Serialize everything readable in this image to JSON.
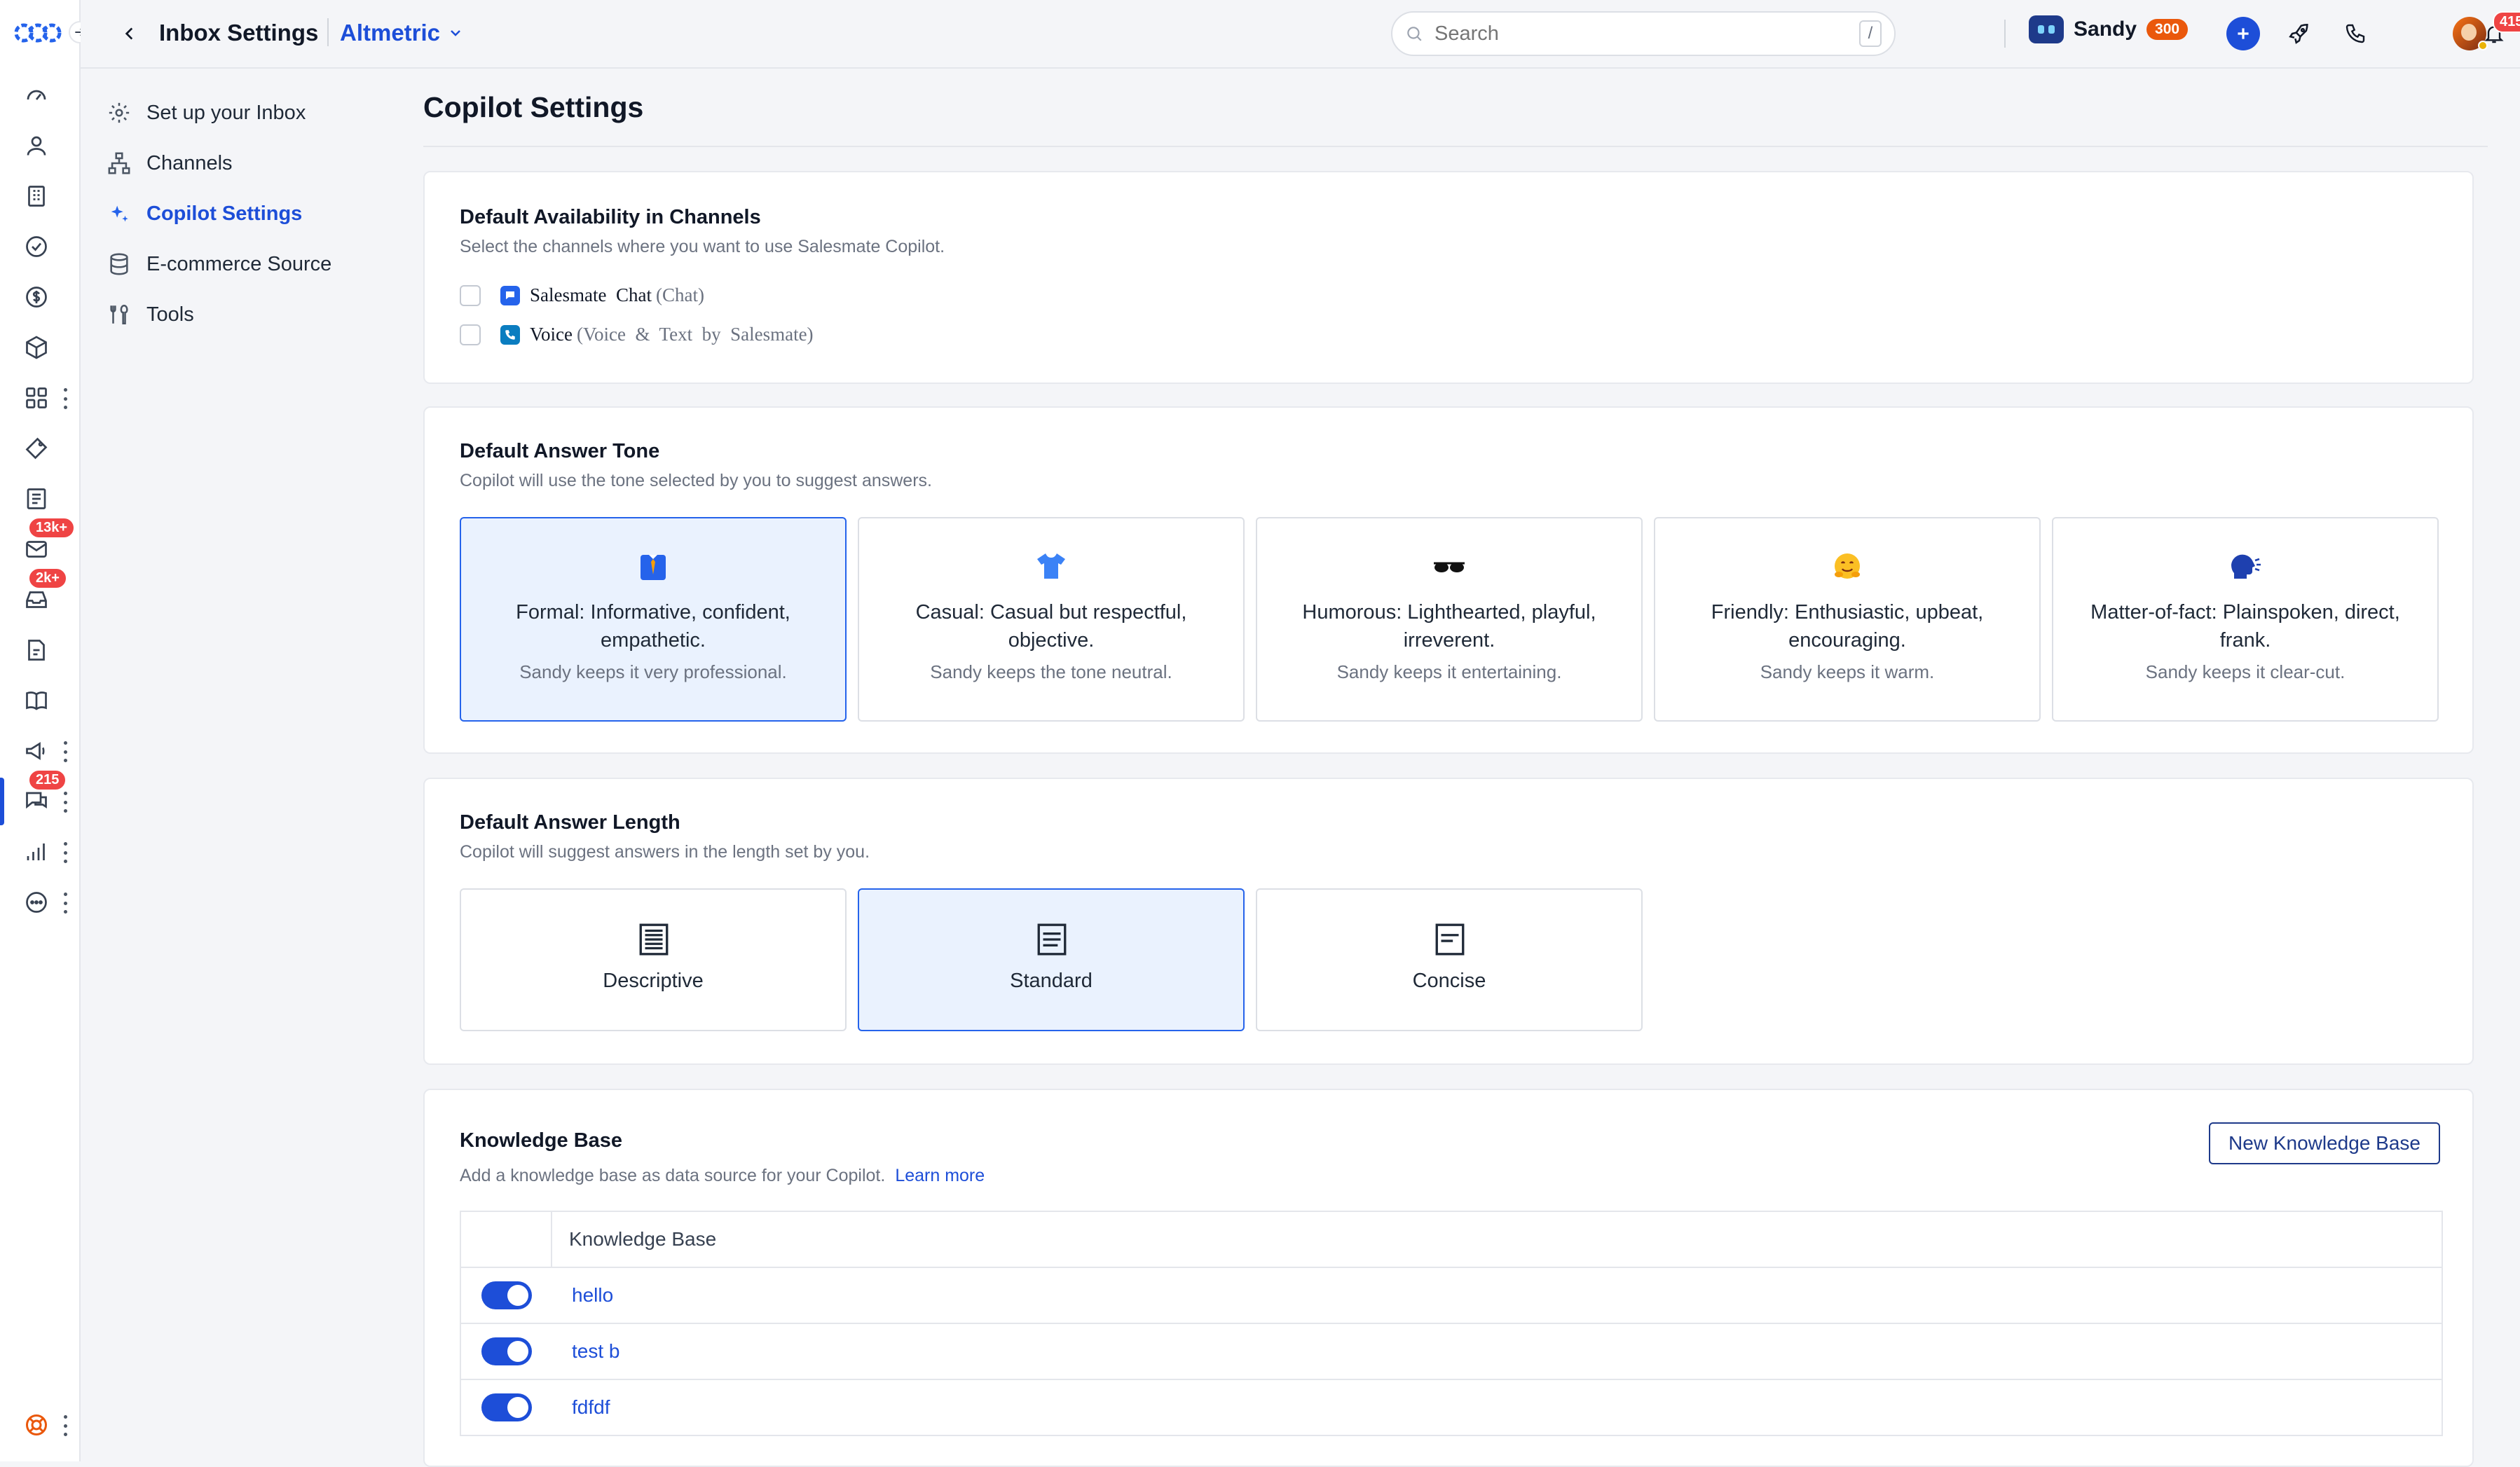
{
  "header": {
    "back_label": "Back",
    "title": "Inbox Settings",
    "workspace": "Altmetric",
    "search": {
      "placeholder": "Search",
      "shortcut": "/"
    },
    "user": {
      "name": "Sandy",
      "credits": "300"
    },
    "notifications_count": "415"
  },
  "rail": {
    "badges": {
      "mail": "13k+",
      "inbox": "2k+",
      "chat": "215"
    }
  },
  "subnav": {
    "items": [
      {
        "label": "Set up your Inbox",
        "icon": "gear-icon"
      },
      {
        "label": "Channels",
        "icon": "sitemap-icon"
      },
      {
        "label": "Copilot Settings",
        "icon": "sparkle-icon",
        "active": true
      },
      {
        "label": "E-commerce Source",
        "icon": "database-icon"
      },
      {
        "label": "Tools",
        "icon": "tools-icon"
      }
    ]
  },
  "main": {
    "title": "Copilot Settings",
    "availability": {
      "title": "Default Availability in Channels",
      "subtitle": "Select the channels where you want to use Salesmate Copilot.",
      "channels": [
        {
          "name": "Salesmate  Chat",
          "detail": "(Chat)",
          "checked": false
        },
        {
          "name": "Voice",
          "detail": "(Voice  &  Text  by  Salesmate)",
          "checked": false
        }
      ]
    },
    "tone": {
      "title": "Default Answer Tone",
      "subtitle": "Copilot will use the tone selected by you to suggest answers.",
      "options": [
        {
          "name": "Formal: Informative, confident, empathetic.",
          "desc": "Sandy keeps it very professional.",
          "emoji": "👔",
          "selected": true
        },
        {
          "name": "Casual: Casual but respectful, objective.",
          "desc": "Sandy keeps the tone neutral.",
          "emoji": "👕",
          "selected": false
        },
        {
          "name": "Humorous: Lighthearted, playful, irreverent.",
          "desc": "Sandy keeps it entertaining.",
          "emoji": "🕶",
          "selected": false
        },
        {
          "name": "Friendly: Enthusiastic, upbeat, encouraging.",
          "desc": "Sandy keeps it warm.",
          "emoji": "🤗",
          "selected": false
        },
        {
          "name": "Matter-of-fact: Plainspoken, direct, frank.",
          "desc": "Sandy keeps it clear-cut.",
          "emoji": "🗣",
          "selected": false
        }
      ]
    },
    "length": {
      "title": "Default Answer Length",
      "subtitle": "Copilot will suggest answers in the length set by you.",
      "options": [
        {
          "name": "Descriptive",
          "selected": false
        },
        {
          "name": "Standard",
          "selected": true
        },
        {
          "name": "Concise",
          "selected": false
        }
      ]
    },
    "knowledge_base": {
      "title": "Knowledge Base",
      "subtitle": "Add a knowledge base as data source for your Copilot.",
      "learn_more": "Learn more",
      "new_button": "New Knowledge Base",
      "column_header": "Knowledge Base",
      "rows": [
        {
          "name": "hello",
          "enabled": true
        },
        {
          "name": "test b",
          "enabled": true
        },
        {
          "name": "fdfdf",
          "enabled": true
        }
      ]
    }
  }
}
